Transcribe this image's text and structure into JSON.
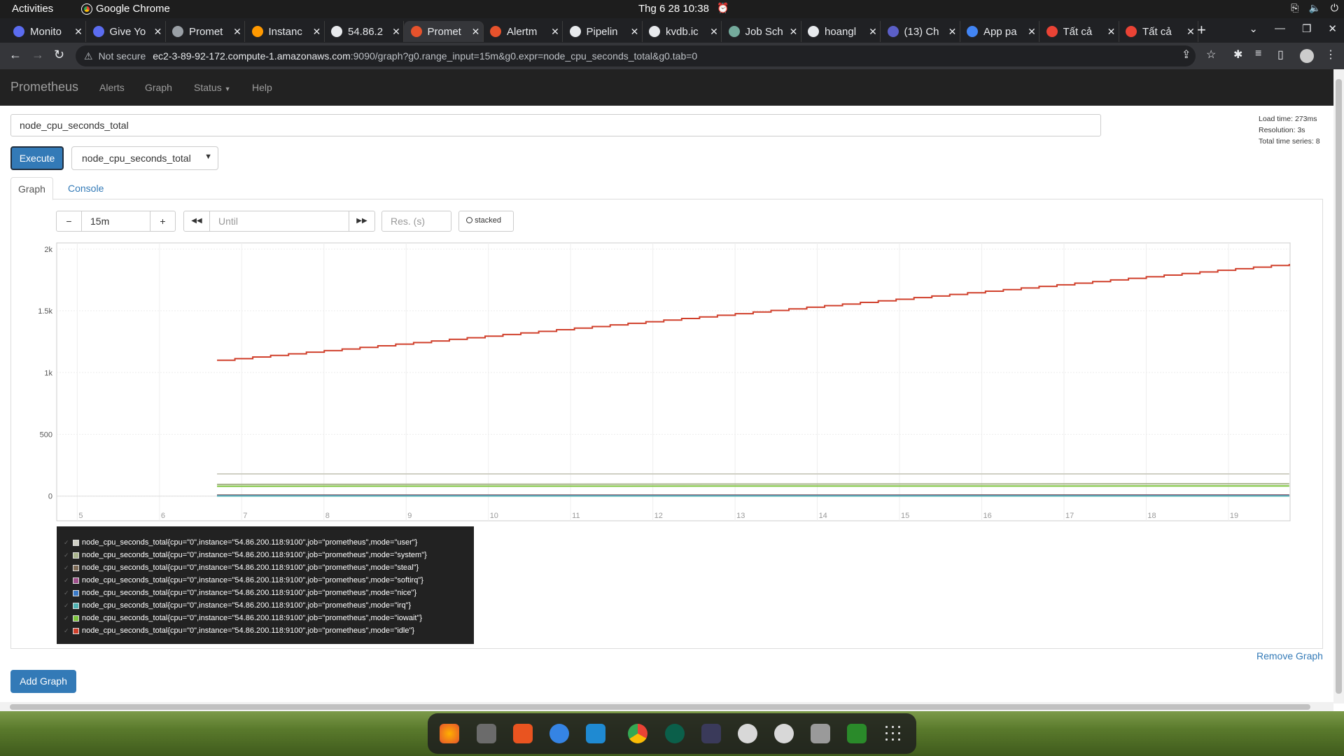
{
  "topbar": {
    "activities": "Activities",
    "app_name": "Google Chrome",
    "clock": "Thg 6 28  10:38"
  },
  "tabs": [
    {
      "title": "Monito",
      "color": "#5b6cf0"
    },
    {
      "title": "Give Yo",
      "color": "#5b6cf0"
    },
    {
      "title": "Promet",
      "color": "#9aa0a6"
    },
    {
      "title": "Instanc",
      "color": "#ff9900"
    },
    {
      "title": "54.86.2",
      "color": "#e8eaed"
    },
    {
      "title": "Promet",
      "color": "#e6522c",
      "active": true
    },
    {
      "title": "Alertm",
      "color": "#e6522c"
    },
    {
      "title": "Pipelin",
      "color": "#e8eaed"
    },
    {
      "title": "kvdb.ic",
      "color": "#e8eaed"
    },
    {
      "title": "Job Sch",
      "color": "#74aa9c"
    },
    {
      "title": "hoangl",
      "color": "#e8eaed"
    },
    {
      "title": "(13) Ch",
      "color": "#5b5fc7"
    },
    {
      "title": "App pa",
      "color": "#4285f4"
    },
    {
      "title": "Tất cả",
      "color": "#ea4335"
    },
    {
      "title": "Tất cả",
      "color": "#ea4335"
    }
  ],
  "address": {
    "security": "Not secure",
    "url_host": "ec2-3-89-92-172.compute-1.amazonaws.com",
    "url_rest": ":9090/graph?g0.range_input=15m&g0.expr=node_cpu_seconds_total&g0.tab=0"
  },
  "nav": {
    "brand": "Prometheus",
    "links": [
      "Alerts",
      "Graph",
      "Status",
      "Help"
    ]
  },
  "query": {
    "expression": "node_cpu_seconds_total",
    "execute_label": "Execute",
    "metric_select": "node_cpu_seconds_total"
  },
  "stats": {
    "load_time": "Load time: 273ms",
    "resolution": "Resolution: 3s",
    "total_series": "Total time series: 8"
  },
  "view_tabs": {
    "graph": "Graph",
    "console": "Console"
  },
  "controls": {
    "range_minus": "−",
    "range_value": "15m",
    "range_plus": "+",
    "back": "◀◀",
    "until_placeholder": "Until",
    "forward": "▶▶",
    "res_placeholder": "Res. (s)",
    "stacked_label": "stacked"
  },
  "chart_data": {
    "type": "line",
    "x_ticks": [
      "5",
      "6",
      "7",
      "8",
      "9",
      "10",
      "11",
      "12",
      "13",
      "14",
      "15",
      "16",
      "17",
      "18",
      "19"
    ],
    "y_ticks": [
      "0",
      "500",
      "1k",
      "1.5k",
      "2k"
    ],
    "ylim": [
      -200,
      2050
    ],
    "xlim": [
      4.75,
      19.75
    ],
    "data_start_x": 6.7,
    "series": [
      {
        "name": "node_cpu_seconds_total{cpu=\"0\",instance=\"54.86.200.118:9100\",job=\"prometheus\",mode=\"user\"}",
        "color": "#cfcfc4",
        "start": 180,
        "end": 180
      },
      {
        "name": "node_cpu_seconds_total{cpu=\"0\",instance=\"54.86.200.118:9100\",job=\"prometheus\",mode=\"system\"}",
        "color": "#a9b48c",
        "start": 95,
        "end": 100
      },
      {
        "name": "node_cpu_seconds_total{cpu=\"0\",instance=\"54.86.200.118:9100\",job=\"prometheus\",mode=\"steal\"}",
        "color": "#7d6a55",
        "start": 8,
        "end": 9
      },
      {
        "name": "node_cpu_seconds_total{cpu=\"0\",instance=\"54.86.200.118:9100\",job=\"prometheus\",mode=\"softirq\"}",
        "color": "#a0508c",
        "start": 5,
        "end": 6
      },
      {
        "name": "node_cpu_seconds_total{cpu=\"0\",instance=\"54.86.200.118:9100\",job=\"prometheus\",mode=\"nice\"}",
        "color": "#3a7ac8",
        "start": 2,
        "end": 2
      },
      {
        "name": "node_cpu_seconds_total{cpu=\"0\",instance=\"54.86.200.118:9100\",job=\"prometheus\",mode=\"irq\"}",
        "color": "#4fb3b3",
        "start": 1,
        "end": 1
      },
      {
        "name": "node_cpu_seconds_total{cpu=\"0\",instance=\"54.86.200.118:9100\",job=\"prometheus\",mode=\"iowait\"}",
        "color": "#7cc43c",
        "start": 80,
        "end": 82
      },
      {
        "name": "node_cpu_seconds_total{cpu=\"0\",instance=\"54.86.200.118:9100\",job=\"prometheus\",mode=\"idle\"}",
        "color": "#d0402c",
        "start": 1100,
        "end": 1880
      }
    ]
  },
  "remove_graph": "Remove Graph",
  "add_graph": "Add Graph"
}
